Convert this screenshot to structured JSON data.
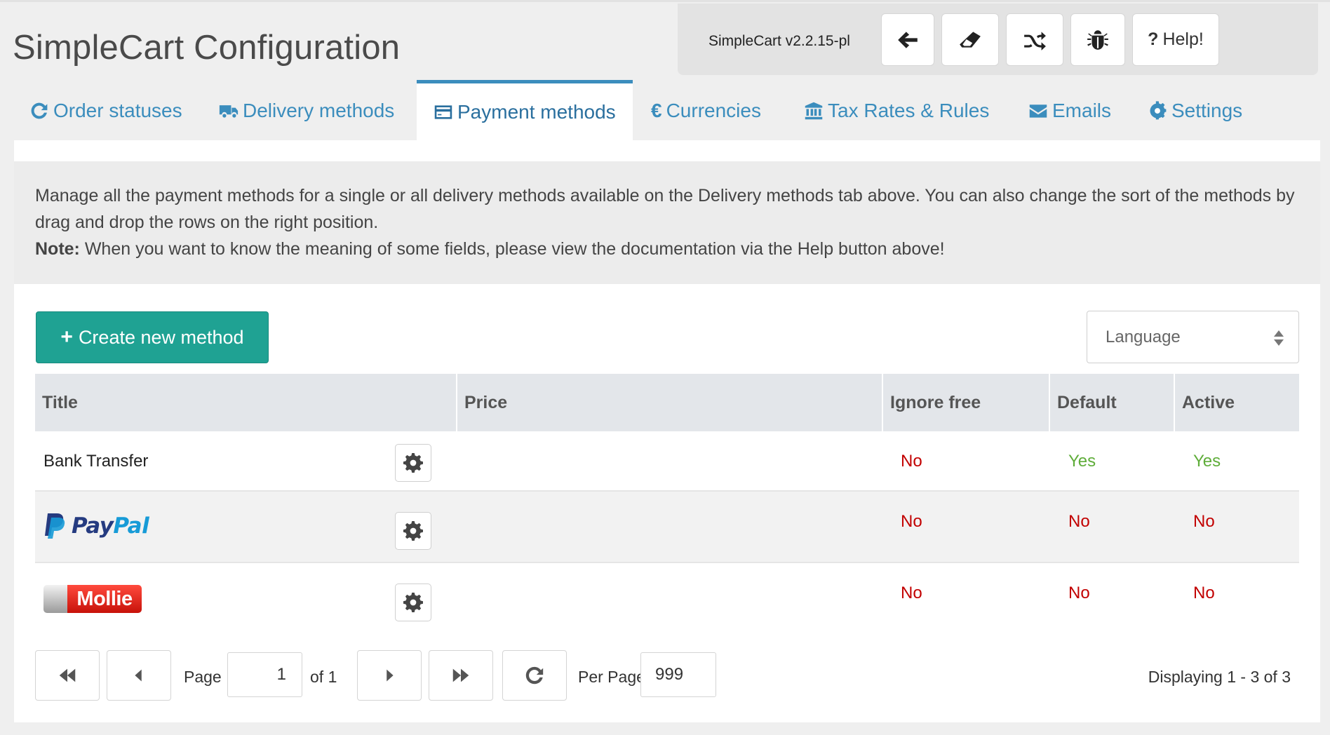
{
  "page": {
    "title": "SimpleCart Configuration"
  },
  "toolbar": {
    "version": "SimpleCart v2.2.15-pl",
    "buttons": [
      {
        "icon": "arrow-left-icon"
      },
      {
        "icon": "eraser-icon"
      },
      {
        "icon": "random-icon"
      },
      {
        "icon": "bug-icon"
      }
    ],
    "help_label": "Help!",
    "help_prefix": "?"
  },
  "tabs": [
    {
      "label": "Order statuses",
      "icon": "refresh-icon"
    },
    {
      "label": "Delivery methods",
      "icon": "truck-icon"
    },
    {
      "label": "Payment methods",
      "icon": "credit-card-icon",
      "active": true
    },
    {
      "label": "Currencies",
      "icon": "euro-icon"
    },
    {
      "label": "Tax Rates & Rules",
      "icon": "bank-icon"
    },
    {
      "label": "Emails",
      "icon": "envelope-icon"
    },
    {
      "label": "Settings",
      "icon": "cog-icon"
    }
  ],
  "info": {
    "text": "Manage all the payment methods for a single or all delivery methods available on the Delivery methods tab above. You can also change the sort of the methods by drag and drop the rows on the right position.",
    "note_label": "Note:",
    "note_text": " When you want to know the meaning of some fields, please view the documentation via the Help button above!"
  },
  "actions": {
    "create_label": "Create new method",
    "language_placeholder": "Language"
  },
  "table": {
    "columns": [
      "Title",
      "Price",
      "Ignore free",
      "Default",
      "Active"
    ],
    "rows": [
      {
        "title": "Bank Transfer",
        "logo": null,
        "ignore_free": "No",
        "default": "Yes",
        "active": "Yes"
      },
      {
        "title": "",
        "logo": "PayPal",
        "logo_parts": [
          "Pay",
          "Pal"
        ],
        "ignore_free": "No",
        "default": "No",
        "active": "No"
      },
      {
        "title": "",
        "logo": "Mollie",
        "ignore_free": "No",
        "default": "No",
        "active": "No"
      }
    ]
  },
  "pager": {
    "page_label": "Page",
    "page_value": "1",
    "of_label": "of 1",
    "per_page_label": "Per Page:",
    "per_page_value": "999",
    "display": "Displaying 1 - 3 of 3"
  },
  "colors": {
    "accent": "#3b8dbd",
    "create_button": "#1fa293",
    "no": "#c20000",
    "yes": "#5fad3a"
  }
}
